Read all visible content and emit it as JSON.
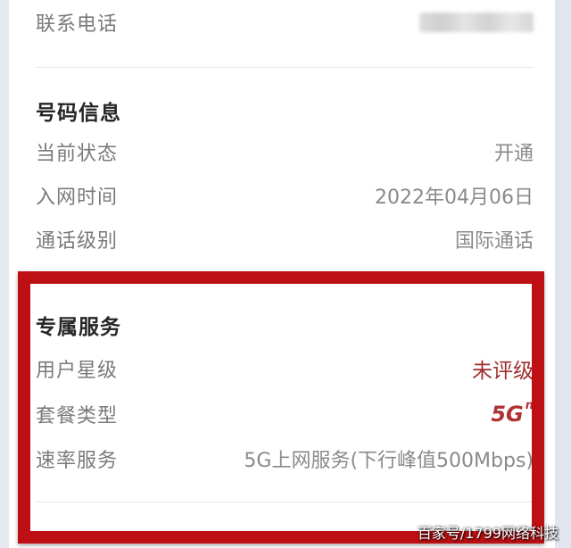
{
  "contact": {
    "label": "联系电话"
  },
  "number_info": {
    "title": "号码信息",
    "rows": [
      {
        "label": "当前状态",
        "value": "开通"
      },
      {
        "label": "入网时间",
        "value": "2022年04月06日"
      },
      {
        "label": "通话级别",
        "value": "国际通话"
      }
    ]
  },
  "exclusive_service": {
    "title": "专属服务",
    "star_level": {
      "label": "用户星级",
      "value": "未评级"
    },
    "plan_type": {
      "label": "套餐类型",
      "badge": "5G",
      "badge_sup": "n"
    },
    "speed_service": {
      "label": "速率服务",
      "value": "5G上网服务(下行峰值500Mbps)"
    }
  },
  "watermark": "百家号/1799网络科技",
  "colors": {
    "highlight_border": "#bd0f14",
    "accent_red": "#a12d2d",
    "label_gray": "#7a7a7a",
    "title_dark": "#262626"
  }
}
